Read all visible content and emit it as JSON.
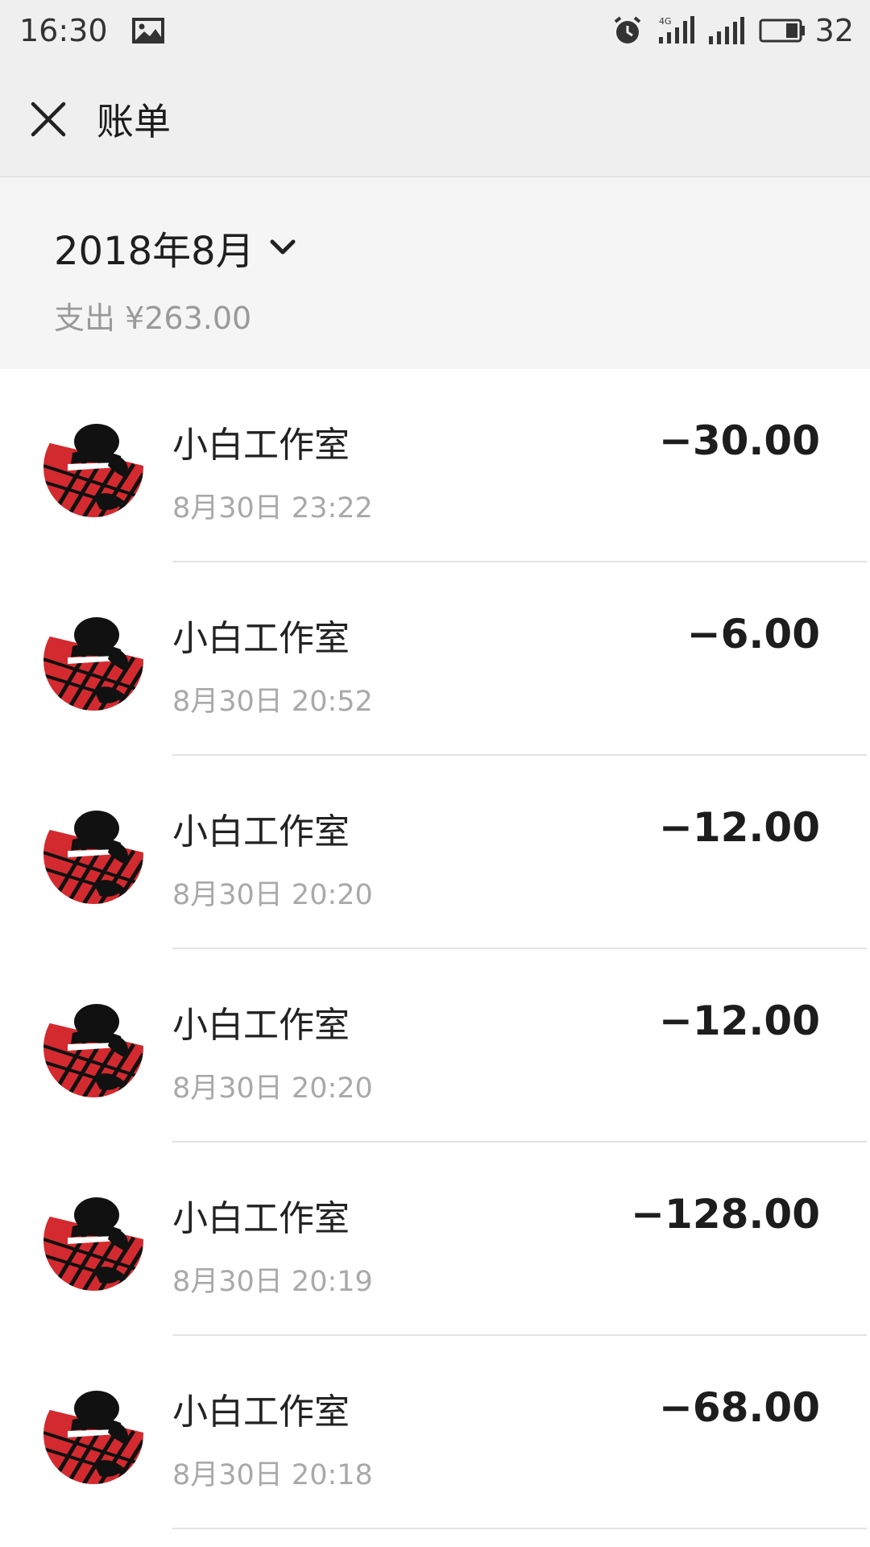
{
  "status_bar": {
    "time": "16:30",
    "battery_level": "32",
    "icons": [
      "gallery-icon",
      "alarm-icon",
      "signal-4g-icon",
      "signal-icon",
      "battery-icon"
    ]
  },
  "header": {
    "title": "账单",
    "close_icon": "close-icon"
  },
  "summary": {
    "month": "2018年8月",
    "total": "支出 ¥263.00"
  },
  "transactions": [
    {
      "name": "小白工作室",
      "time": "8月30日 23:22",
      "amount": "−30.00"
    },
    {
      "name": "小白工作室",
      "time": "8月30日 20:52",
      "amount": "−6.00"
    },
    {
      "name": "小白工作室",
      "time": "8月30日 20:20",
      "amount": "−12.00"
    },
    {
      "name": "小白工作室",
      "time": "8月30日 20:20",
      "amount": "−12.00"
    },
    {
      "name": "小白工作室",
      "time": "8月30日 20:19",
      "amount": "−128.00"
    },
    {
      "name": "小白工作室",
      "time": "8月30日 20:18",
      "amount": "−68.00"
    }
  ],
  "colors": {
    "header_bg": "#efefef",
    "summary_bg": "#f5f5f5",
    "secondary_text": "#a9a9a9",
    "avatar_red": "#d32a2f"
  }
}
